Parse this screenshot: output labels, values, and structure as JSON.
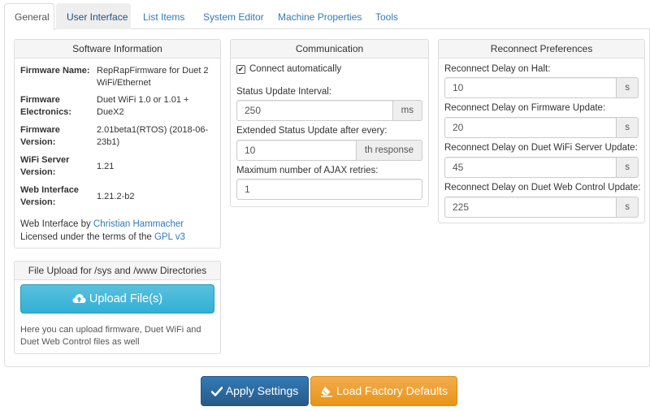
{
  "tabs": [
    {
      "label": "General"
    },
    {
      "label": "User Interface"
    },
    {
      "label": "List Items"
    },
    {
      "label": "System Editor"
    },
    {
      "label": "Machine Properties"
    },
    {
      "label": "Tools"
    }
  ],
  "software": {
    "title": "Software Information",
    "rows": [
      {
        "key": "Firmware Name:",
        "value": "RepRapFirmware for Duet 2 WiFi/Ethernet"
      },
      {
        "key": "Firmware Electronics:",
        "value": "Duet WiFi 1.0 or 1.01 + DueX2"
      },
      {
        "key": "Firmware Version:",
        "value": "2.01beta1(RTOS) (2018-06-23b1)"
      },
      {
        "key": "WiFi Server Version:",
        "value": "1.21"
      },
      {
        "key": "Web Interface Version:",
        "value": "1.21.2-b2"
      }
    ],
    "credit_prefix": "Web Interface by ",
    "credit_author": "Christian Hammacher",
    "license_prefix": "Licensed under the terms of the ",
    "license_link": "GPL v3"
  },
  "upload": {
    "title": "File Upload for /sys and /www Directories",
    "button_label": "Upload File(s)",
    "note": "Here you can upload firmware, Duet WiFi and Duet Web Control files as well"
  },
  "communication": {
    "title": "Communication",
    "connect_label": "Connect automatically",
    "connect_checked": true,
    "status_interval_label": "Status Update Interval:",
    "status_interval_value": "250",
    "status_interval_unit": "ms",
    "extended_label": "Extended Status Update after every:",
    "extended_value": "10",
    "extended_unit": "th response",
    "ajax_label": "Maximum number of AJAX retries:",
    "ajax_value": "1"
  },
  "reconnect": {
    "title": "Reconnect Preferences",
    "fields": [
      {
        "label": "Reconnect Delay on Halt:",
        "value": "10",
        "unit": "s"
      },
      {
        "label": "Reconnect Delay on Firmware Update:",
        "value": "20",
        "unit": "s"
      },
      {
        "label": "Reconnect Delay on Duet WiFi Server Update:",
        "value": "45",
        "unit": "s"
      },
      {
        "label": "Reconnect Delay on Duet Web Control Update:",
        "value": "225",
        "unit": "s"
      }
    ]
  },
  "actions": {
    "apply_label": "Apply Settings",
    "defaults_label": "Load Factory Defaults"
  }
}
